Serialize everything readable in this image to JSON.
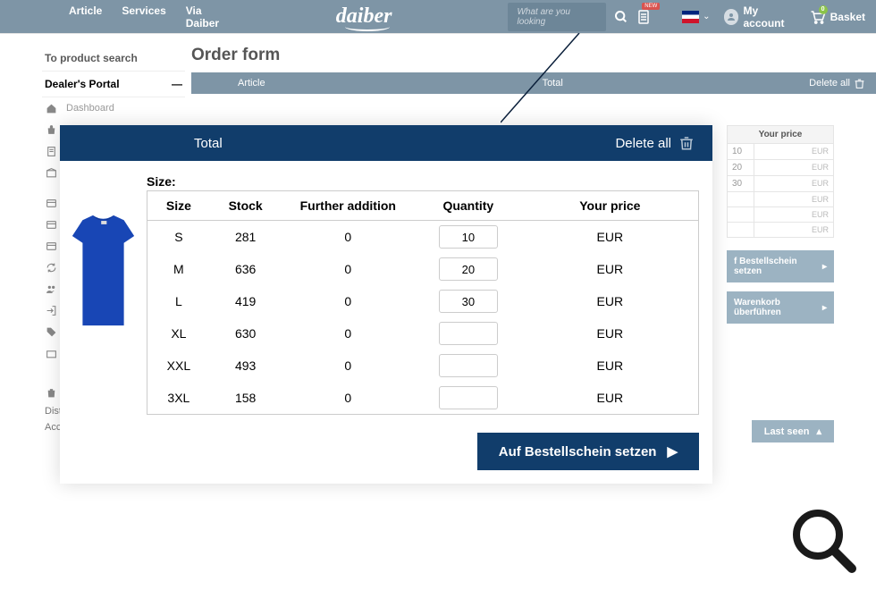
{
  "header": {
    "nav": [
      "Article",
      "Services",
      "Via Daiber"
    ],
    "logo": "daiber",
    "search_placeholder": "What are you looking",
    "account_label": "My account",
    "basket_label": "Basket",
    "basket_count": "0"
  },
  "sidebar": {
    "to_product_search": "To product search",
    "dealers_portal": "Dealer's Portal",
    "dashboard": "Dashboard",
    "distr": "Distr",
    "acco": "Acco"
  },
  "main": {
    "page_title": "Order form",
    "subheader": {
      "article": "Article",
      "total": "Total",
      "delete_all": "Delete all"
    }
  },
  "right_panel": {
    "header": "Your price",
    "rows": [
      {
        "q": "10",
        "c": "EUR"
      },
      {
        "q": "20",
        "c": "EUR"
      },
      {
        "q": "30",
        "c": "EUR"
      },
      {
        "q": "",
        "c": "EUR"
      },
      {
        "q": "",
        "c": "EUR"
      },
      {
        "q": "",
        "c": "EUR"
      }
    ],
    "btn1": "f Bestellschein setzen",
    "btn2": "Warenkorb überführen",
    "last_seen": "Last seen"
  },
  "overlay": {
    "total": "Total",
    "delete_all": "Delete all",
    "size_label": "Size:",
    "cols": {
      "size": "Size",
      "stock": "Stock",
      "fa": "Further addition",
      "qty": "Quantity",
      "price": "Your price"
    },
    "rows": [
      {
        "size": "S",
        "stock": "281",
        "fa": "0",
        "qty": "10",
        "cur": "EUR"
      },
      {
        "size": "M",
        "stock": "636",
        "fa": "0",
        "qty": "20",
        "cur": "EUR"
      },
      {
        "size": "L",
        "stock": "419",
        "fa": "0",
        "qty": "30",
        "cur": "EUR"
      },
      {
        "size": "XL",
        "stock": "630",
        "fa": "0",
        "qty": "",
        "cur": "EUR"
      },
      {
        "size": "XXL",
        "stock": "493",
        "fa": "0",
        "qty": "",
        "cur": "EUR"
      },
      {
        "size": "3XL",
        "stock": "158",
        "fa": "0",
        "qty": "",
        "cur": "EUR"
      }
    ],
    "action_btn": "Auf Bestellschein setzen"
  }
}
